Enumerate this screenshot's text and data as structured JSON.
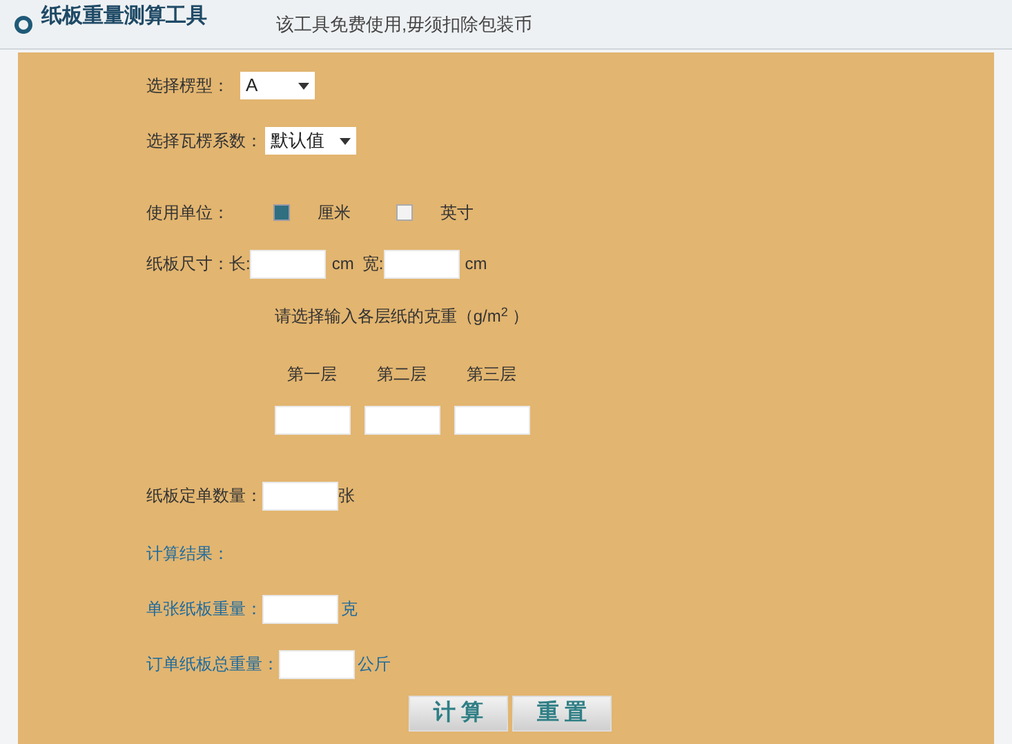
{
  "header": {
    "title": "纸板重量测算工具",
    "notice": "该工具免费使用,毋须扣除包装币"
  },
  "flute_type": {
    "label": "选择楞型：",
    "value": "A"
  },
  "flute_factor": {
    "label": "选择瓦楞系数：",
    "value": "默认值"
  },
  "units": {
    "label": "使用单位：",
    "options": [
      {
        "label": "厘米",
        "selected": true
      },
      {
        "label": "英寸",
        "selected": false
      }
    ]
  },
  "size": {
    "label": "纸板尺寸：",
    "length_label": "长:",
    "length_unit": "cm",
    "width_label": "宽:",
    "width_unit": "cm"
  },
  "layers": {
    "prompt": "请选择输入各层纸的克重（g/m$^{2}$ ）",
    "items": [
      "第一层",
      "第二层",
      "第三层"
    ]
  },
  "quantity": {
    "label": "纸板定单数量：",
    "unit": "张"
  },
  "results": {
    "title": "计算结果：",
    "rows": [
      {
        "label": "单张纸板重量：",
        "unit": "克"
      },
      {
        "label": "订单纸板总重量：",
        "unit": "公斤"
      }
    ]
  },
  "buttons": [
    "计 算",
    "重 置"
  ]
}
